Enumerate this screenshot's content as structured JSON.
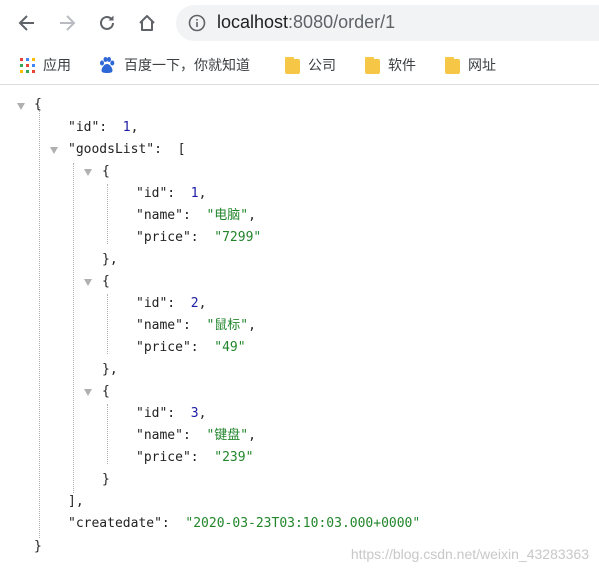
{
  "browser": {
    "url_host": "localhost",
    "url_rest": ":8080/order/1",
    "icons": {
      "back": "arrow-left-icon",
      "forward": "arrow-right-icon",
      "reload": "reload-icon",
      "home": "home-icon",
      "info": "info-icon"
    }
  },
  "bookmarks": [
    {
      "label": "应用",
      "icon": "apps-grid-icon"
    },
    {
      "label": "百度一下，你就知道",
      "icon": "baidu-paw-icon"
    },
    {
      "label": "公司",
      "icon": "folder-icon"
    },
    {
      "label": "软件",
      "icon": "folder-icon"
    },
    {
      "label": "网址",
      "icon": "folder-icon"
    }
  ],
  "json": {
    "id": "1",
    "goodsList": [
      {
        "id": "1",
        "name": "\"电脑\"",
        "price": "\"7299\""
      },
      {
        "id": "2",
        "name": "\"鼠标\"",
        "price": "\"49\""
      },
      {
        "id": "3",
        "name": "\"键盘\"",
        "price": "\"239\""
      }
    ],
    "createdate": "\"2020-03-23T03:10:03.000+0000\""
  },
  "watermark": "https://blog.csdn.net/weixin_43283363",
  "colors": {
    "number": "#1a1aa6",
    "string": "#22862b",
    "key": "#222222",
    "folder": "#f6c746"
  }
}
